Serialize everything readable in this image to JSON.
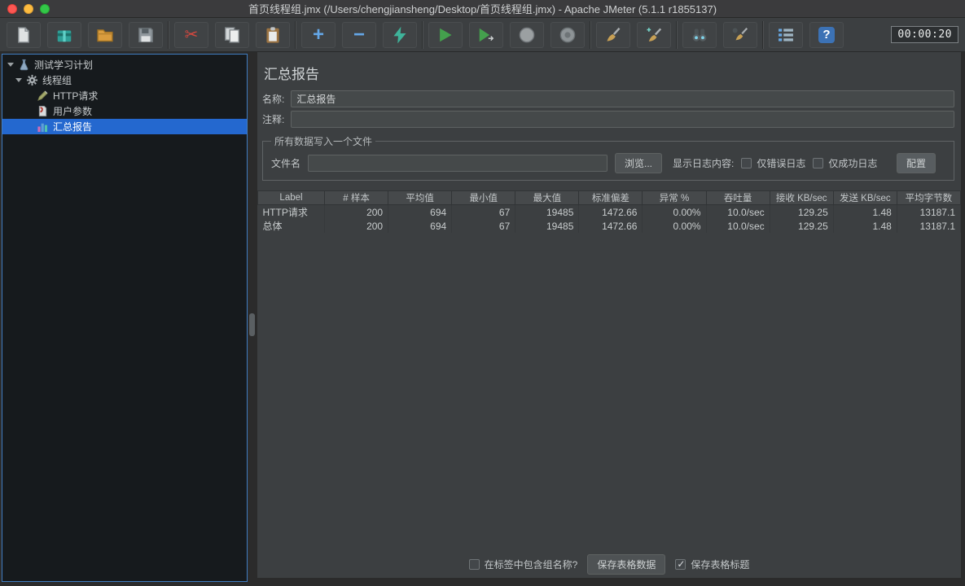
{
  "window": {
    "title": "首页线程组.jmx (/Users/chengjiansheng/Desktop/首页线程组.jmx) - Apache JMeter (5.1.1 r1855137)"
  },
  "toolbar": {
    "timer": "00:00:20",
    "buttons": [
      "new-file",
      "templates",
      "open",
      "save",
      "cut",
      "copy",
      "paste",
      "add",
      "remove",
      "toggle",
      "start",
      "start-no-pauses",
      "stop",
      "shutdown",
      "clear",
      "clear-all",
      "search",
      "clear-search",
      "function-helper",
      "help"
    ]
  },
  "icons": {
    "cut": "✂",
    "add": "+",
    "remove": "−",
    "help": "?"
  },
  "tree": {
    "items": [
      {
        "label": "测试学习计划"
      },
      {
        "label": "线程组"
      },
      {
        "label": "HTTP请求"
      },
      {
        "label": "用户参数"
      },
      {
        "label": "汇总报告"
      }
    ]
  },
  "main": {
    "title": "汇总报告",
    "name": {
      "label": "名称:",
      "value": "汇总报告"
    },
    "comment": {
      "label": "注释:",
      "value": ""
    },
    "file": {
      "legend": "所有数据写入一个文件",
      "filename_label": "文件名",
      "filename_value": "",
      "browse": "浏览...",
      "log_label": "显示日志内容:",
      "errors_only": "仅错误日志",
      "success_only": "仅成功日志",
      "configure": "配置"
    },
    "table": {
      "headers": [
        "Label",
        "# 样本",
        "平均值",
        "最小值",
        "最大值",
        "标准偏差",
        "异常 %",
        "吞吐量",
        "接收 KB/sec",
        "发送 KB/sec",
        "平均字节数"
      ],
      "rows": [
        [
          "HTTP请求",
          "200",
          "694",
          "67",
          "19485",
          "1472.66",
          "0.00%",
          "10.0/sec",
          "129.25",
          "1.48",
          "13187.1"
        ],
        [
          "总体",
          "200",
          "694",
          "67",
          "19485",
          "1472.66",
          "0.00%",
          "10.0/sec",
          "129.25",
          "1.48",
          "13187.1"
        ]
      ]
    },
    "footer": {
      "include_group": "在标签中包含组名称?",
      "save_data": "保存表格数据",
      "save_header": "保存表格标题"
    }
  },
  "colors": {
    "selection_blue": "#2468cf",
    "tree_focus_border": "#3f7cc1",
    "play_green": "#44a04d",
    "panel_bg": "#3c3f41",
    "tree_bg": "#161a1d"
  }
}
